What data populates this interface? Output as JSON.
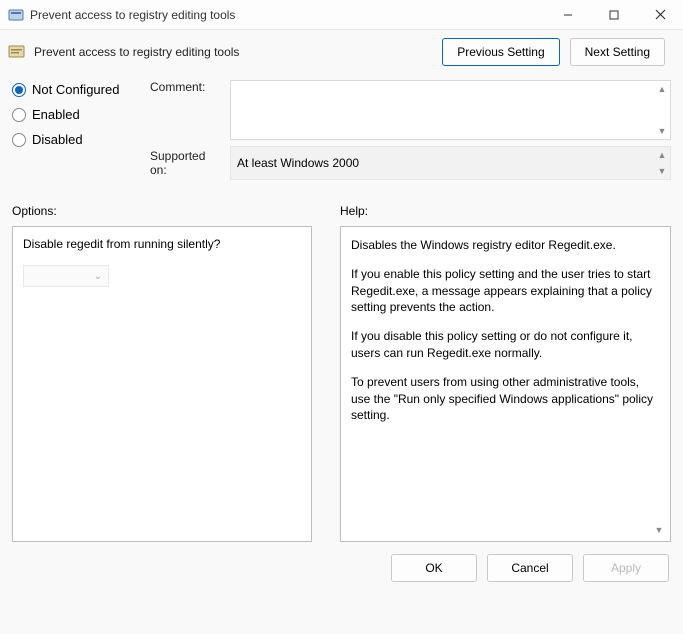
{
  "window": {
    "title": "Prevent access to registry editing tools"
  },
  "header": {
    "title": "Prevent access to registry editing tools",
    "prev_setting": "Previous Setting",
    "next_setting": "Next Setting"
  },
  "radios": {
    "not_configured": "Not Configured",
    "enabled": "Enabled",
    "disabled": "Disabled",
    "selected": "not_configured"
  },
  "labels": {
    "comment": "Comment:",
    "supported_on": "Supported on:",
    "options": "Options:",
    "help": "Help:"
  },
  "supported_on_value": "At least Windows 2000",
  "options": {
    "question": "Disable regedit from running silently?"
  },
  "help": {
    "p1": "Disables the Windows registry editor Regedit.exe.",
    "p2": "If you enable this policy setting and the user tries to start Regedit.exe, a message appears explaining that a policy setting prevents the action.",
    "p3": "If you disable this policy setting or do not configure it, users can run Regedit.exe normally.",
    "p4": "To prevent users from using other administrative tools, use the \"Run only specified Windows applications\" policy setting."
  },
  "footer": {
    "ok": "OK",
    "cancel": "Cancel",
    "apply": "Apply"
  }
}
